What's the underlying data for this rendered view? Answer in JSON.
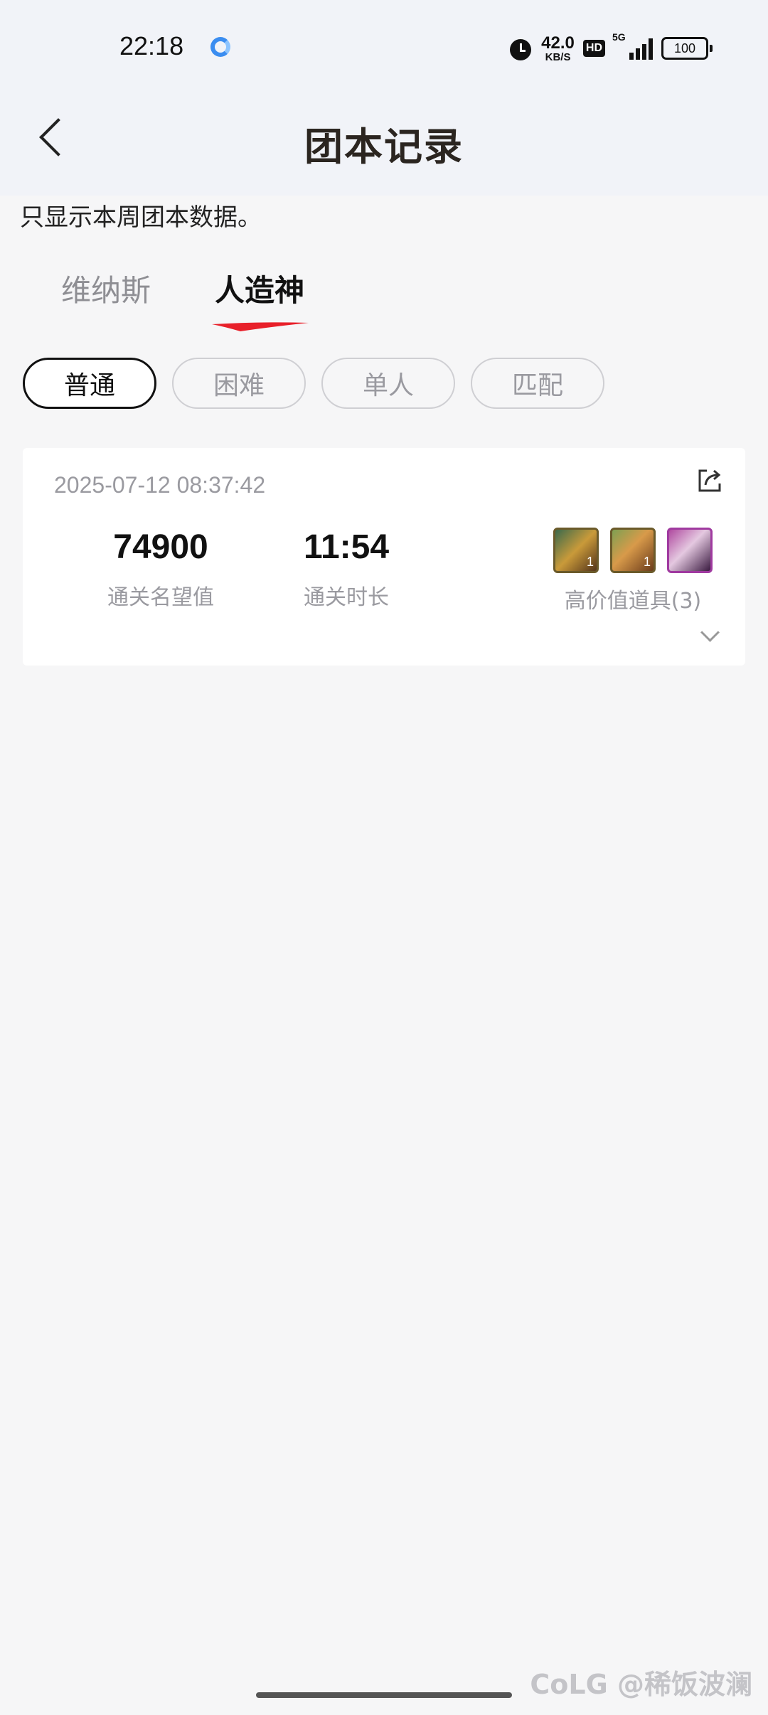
{
  "status_bar": {
    "time": "22:18",
    "net_speed_value": "42.0",
    "net_speed_unit": "KB/S",
    "hd": "HD",
    "network": "5G",
    "battery": "100"
  },
  "header": {
    "title": "团本记录"
  },
  "notice": "只显示本周团本数据。",
  "tabs": [
    {
      "label": "维纳斯",
      "active": false
    },
    {
      "label": "人造神",
      "active": true
    }
  ],
  "filters": [
    {
      "label": "普通",
      "active": true
    },
    {
      "label": "困难",
      "active": false
    },
    {
      "label": "单人",
      "active": false
    },
    {
      "label": "匹配",
      "active": false
    }
  ],
  "records": [
    {
      "datetime": "2025-07-12 08:37:42",
      "fame_value": "74900",
      "fame_label": "通关名望值",
      "duration_value": "11:54",
      "duration_label": "通关时长",
      "items_label": "高价值道具(3)",
      "items": [
        {
          "icon": "gold-trinket-item-icon",
          "qty": "1"
        },
        {
          "icon": "cannon-item-icon",
          "qty": "1"
        },
        {
          "icon": "purple-chest-item-icon",
          "qty": ""
        }
      ]
    }
  ],
  "watermark": "CoLG @稀饭波澜",
  "colors": {
    "accent": "#e8202a",
    "header_bg": "#f1f3f8",
    "page_bg": "#f6f6f7"
  }
}
